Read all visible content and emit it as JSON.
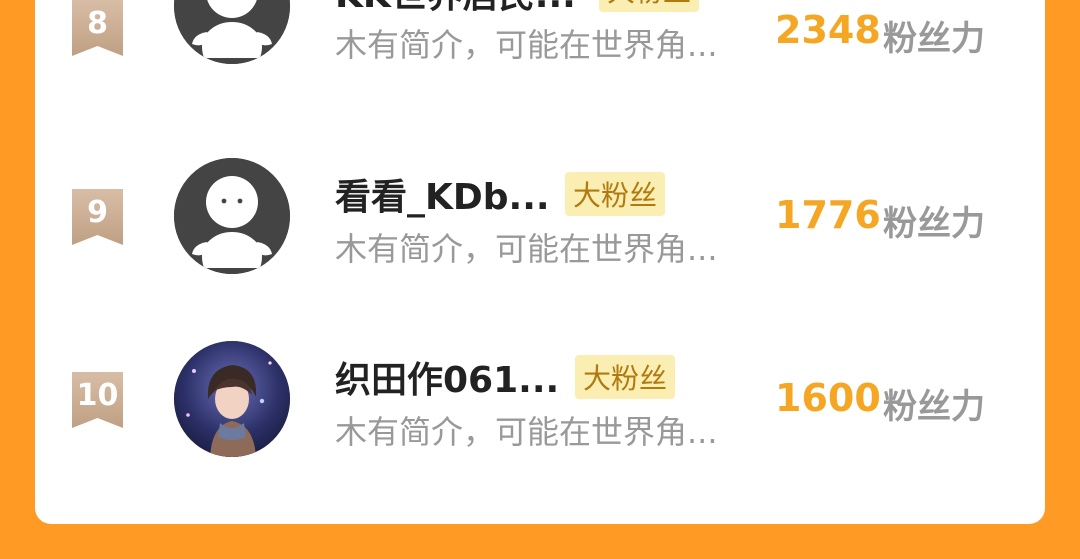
{
  "ranking": [
    {
      "rank": "8",
      "name": "KK世界居民...",
      "badge": "大粉丝",
      "bio": "木有简介，可能在世界角...",
      "score": "2348",
      "score_label": "粉丝力",
      "avatar": "default-avatar-icon"
    },
    {
      "rank": "9",
      "name": "看看_KDb...",
      "badge": "大粉丝",
      "bio": "木有简介，可能在世界角...",
      "score": "1776",
      "score_label": "粉丝力",
      "avatar": "default-avatar-icon"
    },
    {
      "rank": "10",
      "name": "织田作061...",
      "badge": "大粉丝",
      "bio": "木有简介，可能在世界角...",
      "score": "1600",
      "score_label": "粉丝力",
      "avatar": "anime-avatar-image"
    }
  ],
  "colors": {
    "background": "#ff9a24",
    "score": "#f5a623",
    "badge_bg": "#fbeeb3",
    "rank_ribbon": "#c9a98a"
  }
}
